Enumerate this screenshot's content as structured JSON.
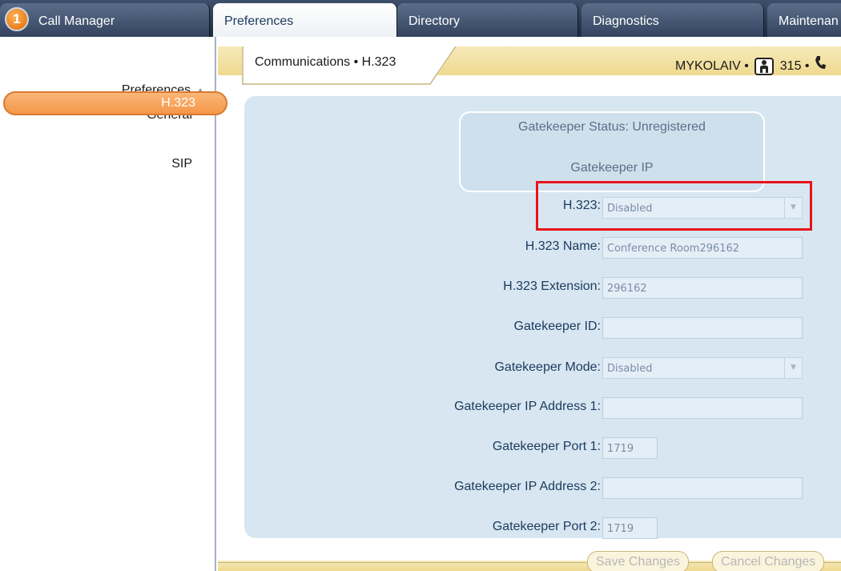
{
  "tabs": [
    {
      "label": "Call Manager",
      "badge": "1"
    },
    {
      "label": "Preferences"
    },
    {
      "label": "Directory"
    },
    {
      "label": "Diagnostics"
    },
    {
      "label": "Maintenan"
    }
  ],
  "sidebar": {
    "header": "Preferences",
    "items": [
      "General",
      "H.323",
      "SIP"
    ]
  },
  "content": {
    "breadcrumb": "Communications • H.323",
    "location": "MYKOLAIV •",
    "room_count": "315 •"
  },
  "gatekeeper": {
    "status": "Gatekeeper Status: Unregistered",
    "ip_label": "Gatekeeper IP"
  },
  "form": {
    "h323_label": "H.323:",
    "h323_value": "Disabled",
    "name_label": "H.323 Name:",
    "name_value": "Conference Room296162",
    "extension_label": "H.323 Extension:",
    "extension_value": "296162",
    "gk_id_label": "Gatekeeper ID:",
    "gk_id_value": "",
    "gk_mode_label": "Gatekeeper Mode:",
    "gk_mode_value": "Disabled",
    "gk_ip1_label": "Gatekeeper IP Address 1:",
    "gk_ip1_value": "",
    "gk_port1_label": "Gatekeeper Port 1:",
    "gk_port1_value": "1719",
    "gk_ip2_label": "Gatekeeper IP Address 2:",
    "gk_ip2_value": "",
    "gk_port2_label": "Gatekeeper Port 2:",
    "gk_port2_value": "1719"
  },
  "footer": {
    "save_label": "Save Changes",
    "cancel_label": "Cancel Changes"
  },
  "colors": {
    "accent_orange": "#f49749",
    "panel_blue": "#d7e6f1",
    "highlight_red": "#e8141c",
    "header_gold": "#efd98f"
  }
}
